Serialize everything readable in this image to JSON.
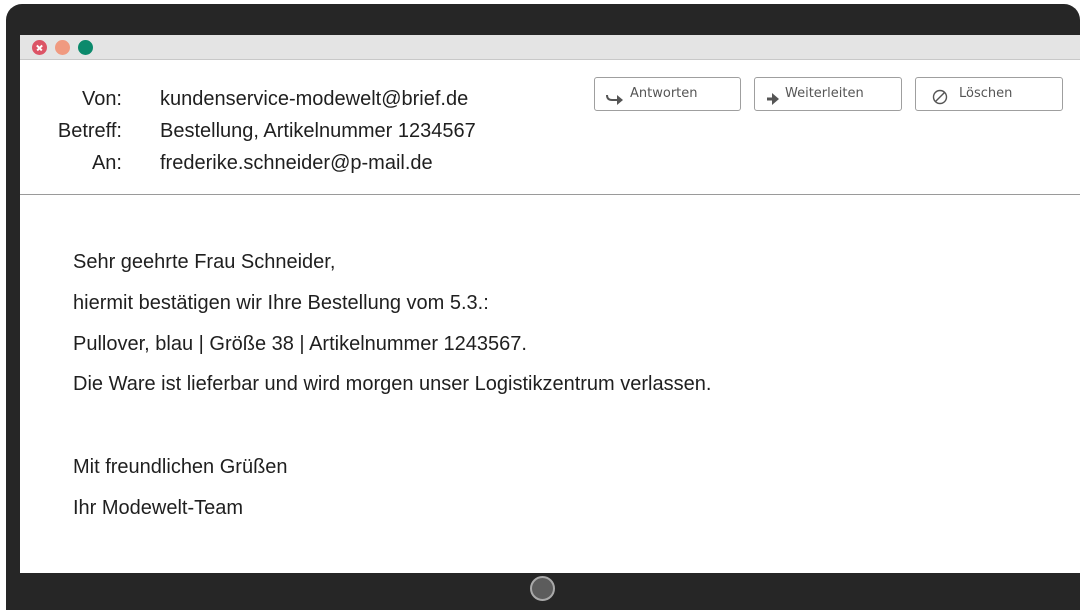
{
  "header": {
    "from_label": "Von:",
    "from_value": "kundenservice-modewelt@brief.de",
    "subject_label": "Betreff:",
    "subject_value": "Bestellung, Artikelnummer 1234567",
    "to_label": "An:",
    "to_value": "frederike.schneider@p-mail.de"
  },
  "toolbar": {
    "reply_label": "Antworten",
    "reply_icon": "reply-arrow-icon",
    "forward_label": "Weiterleiten",
    "forward_icon": "forward-arrow-icon",
    "delete_label": "Löschen",
    "delete_icon": "no-entry-icon"
  },
  "body": {
    "greeting": "Sehr geehrte Frau Schneider,",
    "line1": "hiermit bestätigen wir Ihre Bestellung vom 5.3.:",
    "line2": "Pullover, blau | Größe 38 | Artikelnummer 1243567.",
    "line3": "Die Ware ist lieferbar und wird morgen unser Logistikzentrum verlassen.",
    "closing": "Mit freundlichen Grüßen",
    "signature": "Ihr Modewelt-Team"
  },
  "colors": {
    "close": "#dc5466",
    "minimize": "#f09a80",
    "maximize": "#0c8a6c",
    "frame": "#262626"
  }
}
